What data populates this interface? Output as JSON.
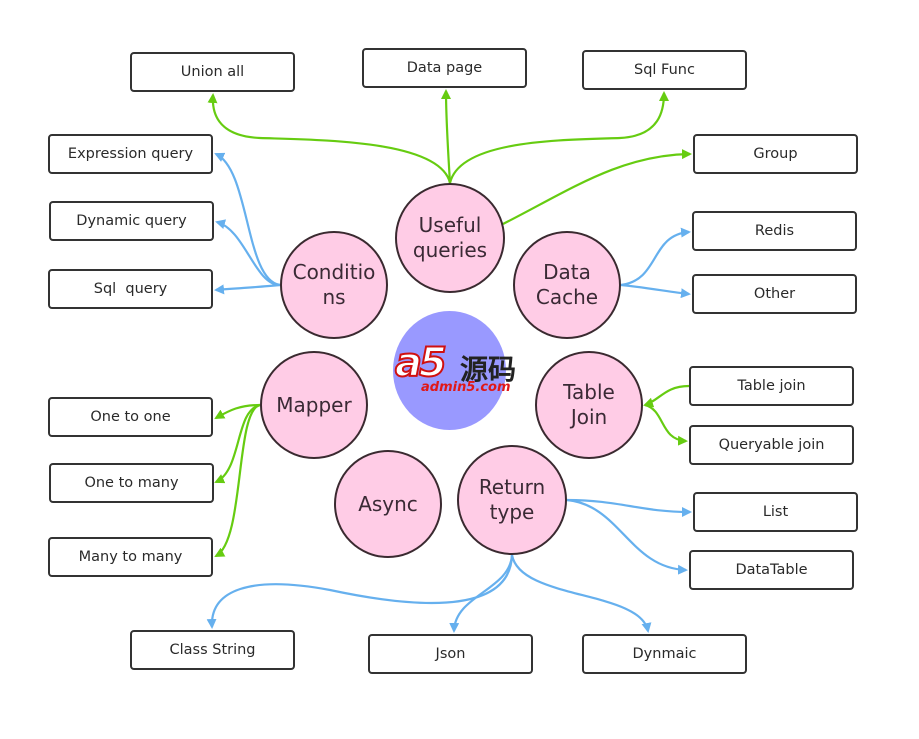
{
  "colors": {
    "circle_fill": "#ffcce6",
    "green_edge": "#66cc11",
    "blue_edge": "#66b0ee",
    "logo_disc": "#9999ff"
  },
  "logo": {
    "brand": "a5",
    "chinese": "源码",
    "url": "admin5.com"
  },
  "hubs": [
    {
      "id": "useful",
      "label": "Useful\nqueries"
    },
    {
      "id": "conditions",
      "label": "Conditio\nns"
    },
    {
      "id": "cache",
      "label": "Data\nCache"
    },
    {
      "id": "mapper",
      "label": "Mapper"
    },
    {
      "id": "tablejoin",
      "label": "Table\nJoin"
    },
    {
      "id": "async",
      "label": "Async"
    },
    {
      "id": "returntype",
      "label": "Return\ntype"
    }
  ],
  "leaves": [
    {
      "id": "union",
      "label": "Union all",
      "hub": "useful",
      "edge": "green"
    },
    {
      "id": "datapage",
      "label": "Data page",
      "hub": "useful",
      "edge": "green"
    },
    {
      "id": "sqlfunc",
      "label": "Sql Func",
      "hub": "useful",
      "edge": "green"
    },
    {
      "id": "group",
      "label": "Group",
      "hub": "useful",
      "edge": "green"
    },
    {
      "id": "expr",
      "label": "Expression query",
      "hub": "conditions",
      "edge": "blue"
    },
    {
      "id": "dynq",
      "label": "Dynamic query",
      "hub": "conditions",
      "edge": "blue"
    },
    {
      "id": "sqlq",
      "label": "Sql  query",
      "hub": "conditions",
      "edge": "blue"
    },
    {
      "id": "redis",
      "label": "Redis",
      "hub": "cache",
      "edge": "blue"
    },
    {
      "id": "other",
      "label": "Other",
      "hub": "cache",
      "edge": "blue"
    },
    {
      "id": "o2o",
      "label": "One to one",
      "hub": "mapper",
      "edge": "green"
    },
    {
      "id": "o2m",
      "label": "One to many",
      "hub": "mapper",
      "edge": "green"
    },
    {
      "id": "m2m",
      "label": "Many to many",
      "hub": "mapper",
      "edge": "green"
    },
    {
      "id": "tj",
      "label": "Table join",
      "hub": "tablejoin",
      "edge": "green"
    },
    {
      "id": "qj",
      "label": "Queryable join",
      "hub": "tablejoin",
      "edge": "green"
    },
    {
      "id": "list",
      "label": "List",
      "hub": "returntype",
      "edge": "blue"
    },
    {
      "id": "datatable",
      "label": "DataTable",
      "hub": "returntype",
      "edge": "blue"
    },
    {
      "id": "classstr",
      "label": "Class String",
      "hub": "returntype",
      "edge": "blue"
    },
    {
      "id": "json",
      "label": "Json",
      "hub": "returntype",
      "edge": "blue"
    },
    {
      "id": "dynmaic",
      "label": "Dynmaic",
      "hub": "returntype",
      "edge": "blue"
    }
  ]
}
